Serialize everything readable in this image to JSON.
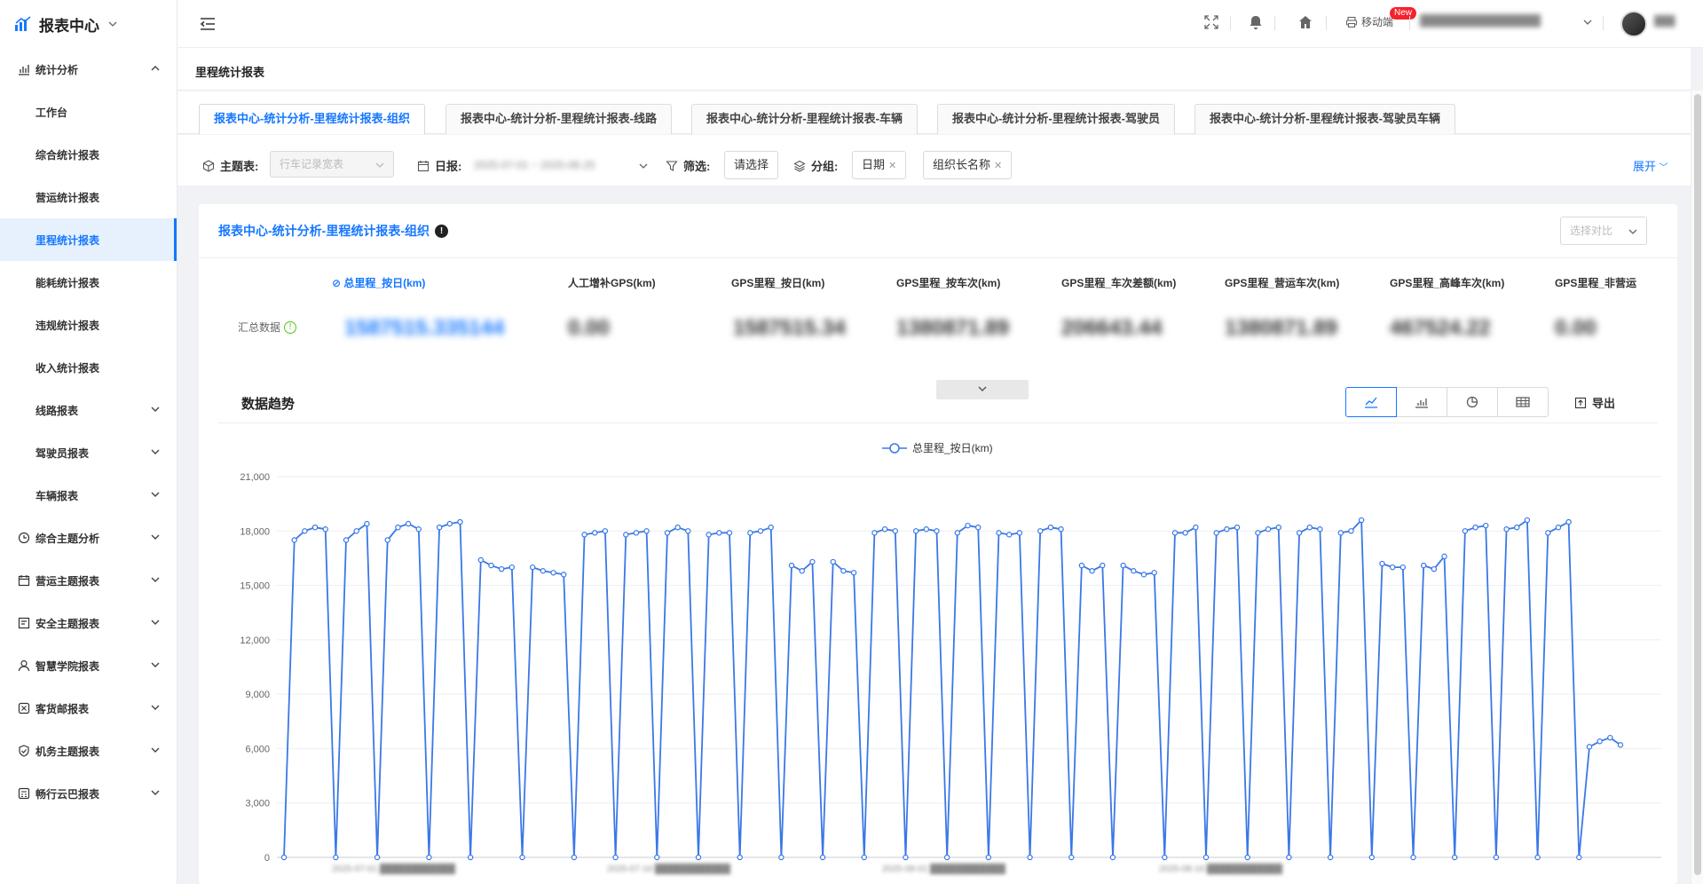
{
  "app": {
    "title": "报表中心"
  },
  "sidebar": {
    "groups": [
      {
        "label": "统计分析",
        "icon": "bar-chart-icon",
        "expanded": true
      },
      {
        "label": "工作台"
      },
      {
        "label": "综合统计报表"
      },
      {
        "label": "营运统计报表"
      },
      {
        "label": "里程统计报表",
        "active": true
      },
      {
        "label": "能耗统计报表"
      },
      {
        "label": "违规统计报表"
      },
      {
        "label": "收入统计报表"
      },
      {
        "label": "线路报表"
      },
      {
        "label": "驾驶员报表"
      },
      {
        "label": "车辆报表"
      },
      {
        "label": "综合主题分析",
        "icon": "clock-icon"
      },
      {
        "label": "营运主题报表",
        "icon": "calendar-icon"
      },
      {
        "label": "安全主题报表",
        "icon": "form-icon"
      },
      {
        "label": "智慧学院报表",
        "icon": "user-icon"
      },
      {
        "label": "客货邮报表",
        "icon": "badge-icon"
      },
      {
        "label": "机务主题报表",
        "icon": "shield-icon"
      },
      {
        "label": "畅行云巴报表",
        "icon": "calc-icon"
      }
    ]
  },
  "header": {
    "mobile_label": "移动端",
    "new_badge": "New",
    "user_org": "████████████████",
    "user_name": "███"
  },
  "page": {
    "title": "里程统计报表"
  },
  "tabs": [
    {
      "label": "报表中心-统计分析-里程统计报表-组织",
      "active": true
    },
    {
      "label": "报表中心-统计分析-里程统计报表-线路"
    },
    {
      "label": "报表中心-统计分析-里程统计报表-车辆"
    },
    {
      "label": "报表中心-统计分析-里程统计报表-驾驶员"
    },
    {
      "label": "报表中心-统计分析-里程统计报表-驾驶员车辆"
    }
  ],
  "filters": {
    "theme_label": "主题表:",
    "theme_value": "行车记录宽表",
    "date_label": "日报:",
    "date_value": "2025-07-01 ~ 2025-08-25",
    "filter_label": "筛选:",
    "filter_button": "请选择",
    "group_label": "分组:",
    "group_chips": [
      "日期",
      "组织长名称"
    ],
    "expand_label": "展开"
  },
  "report": {
    "title": "报表中心-统计分析-里程统计报表-组织",
    "compare_placeholder": "选择对比",
    "summary_label": "汇总数据",
    "metrics": [
      {
        "label": "总里程_按日(km)",
        "value": "1587515.335144",
        "active": true
      },
      {
        "label": "人工增补GPS(km)",
        "value": "0.00"
      },
      {
        "label": "GPS里程_按日(km)",
        "value": "1587515.34"
      },
      {
        "label": "GPS里程_按车次(km)",
        "value": "1380871.89"
      },
      {
        "label": "GPS里程_车次差额(km)",
        "value": "206643.44"
      },
      {
        "label": "GPS里程_营运车次(km)",
        "value": "1380871.89"
      },
      {
        "label": "GPS里程_高峰车次(km)",
        "value": "467524.22"
      },
      {
        "label": "GPS里程_非营运",
        "value": "0.00"
      }
    ],
    "trend_title": "数据趋势",
    "export_label": "导出",
    "x_labels_blurred": [
      "2025-07-01 ████████████",
      "2025-07-16 ████████████",
      "2025-08-01 ████████████",
      "2025-08-16 ████████████"
    ]
  },
  "colors": {
    "accent": "#1677ff",
    "line": "#3a78e7"
  },
  "chart_data": {
    "type": "line",
    "legend": [
      "总里程_按日(km)"
    ],
    "ylim": [
      0,
      21000
    ],
    "yticks": [
      "0",
      "3,000",
      "6,000",
      "9,000",
      "12,000",
      "15,000",
      "18,000",
      "21,000"
    ],
    "series": [
      {
        "name": "总里程_按日(km)",
        "values": [
          0,
          17500,
          18000,
          18200,
          18100,
          0,
          17500,
          18000,
          18400,
          0,
          17500,
          18200,
          18400,
          18100,
          0,
          18200,
          18400,
          18500,
          0,
          16400,
          16100,
          15900,
          16000,
          0,
          16000,
          15800,
          15700,
          15600,
          0,
          17800,
          17900,
          18000,
          0,
          17800,
          17900,
          18000,
          0,
          17900,
          18200,
          18000,
          0,
          17800,
          17900,
          17900,
          0,
          17900,
          18000,
          18200,
          0,
          16100,
          15800,
          16300,
          0,
          16300,
          15800,
          15700,
          0,
          17900,
          18100,
          18000,
          0,
          18000,
          18100,
          18000,
          0,
          17900,
          18300,
          18200,
          0,
          17900,
          17800,
          17900,
          0,
          18000,
          18200,
          18100,
          0,
          16100,
          15800,
          16100,
          0,
          16100,
          15800,
          15600,
          15700,
          0,
          17900,
          17900,
          18200,
          0,
          17900,
          18100,
          18200,
          0,
          17900,
          18100,
          18200,
          0,
          17900,
          18200,
          18100,
          0,
          17900,
          18000,
          18600,
          0,
          16200,
          16000,
          16000,
          0,
          16100,
          15900,
          16600,
          0,
          18000,
          18200,
          18300,
          0,
          18100,
          18200,
          18600,
          0,
          17900,
          18200,
          18500,
          0,
          6100,
          6400,
          6600,
          6200
        ]
      }
    ]
  }
}
